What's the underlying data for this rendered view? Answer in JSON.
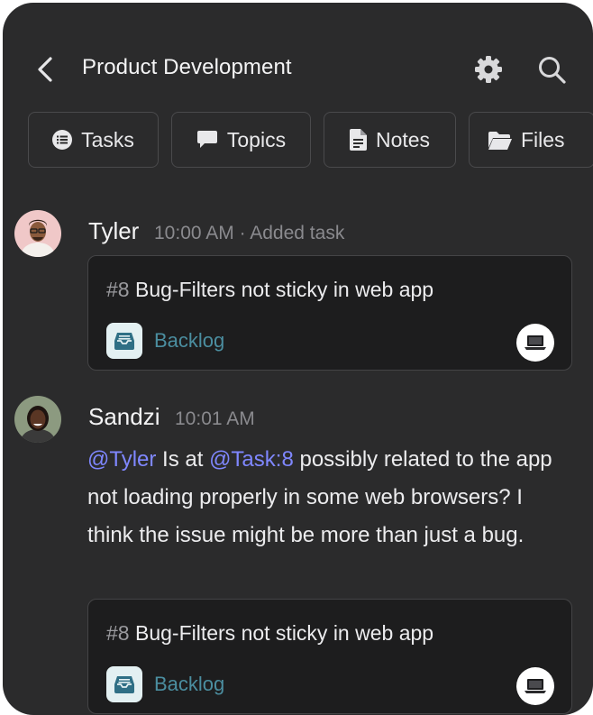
{
  "header": {
    "title": "Product Development"
  },
  "tabs": [
    {
      "label": "Tasks",
      "icon": "list-icon"
    },
    {
      "label": "Topics",
      "icon": "chat-bubble-icon"
    },
    {
      "label": "Notes",
      "icon": "document-icon"
    },
    {
      "label": "Files",
      "icon": "folder-icon"
    }
  ],
  "messages": [
    {
      "author": "Tyler",
      "time": "10:00 AM",
      "action": "· Added task",
      "task": {
        "number": "#8",
        "title": "Bug-Filters not sticky in web app",
        "status": "Backlog"
      }
    },
    {
      "author": "Sandzi",
      "time": "10:01 AM",
      "mention_user": "@Tyler",
      "text_1": " Is at ",
      "mention_task": "@Task:8",
      "text_2": " possibly related to the app not loading properly in some web browsers? I think the issue might be more than just a bug.",
      "task": {
        "number": "#8",
        "title": "Bug-Filters not sticky in web app",
        "status": "Backlog"
      }
    }
  ],
  "colors": {
    "background": "#2b2b2c",
    "card": "#1d1d1e",
    "mention": "#7f87ff",
    "status": "#4b8ea0"
  }
}
